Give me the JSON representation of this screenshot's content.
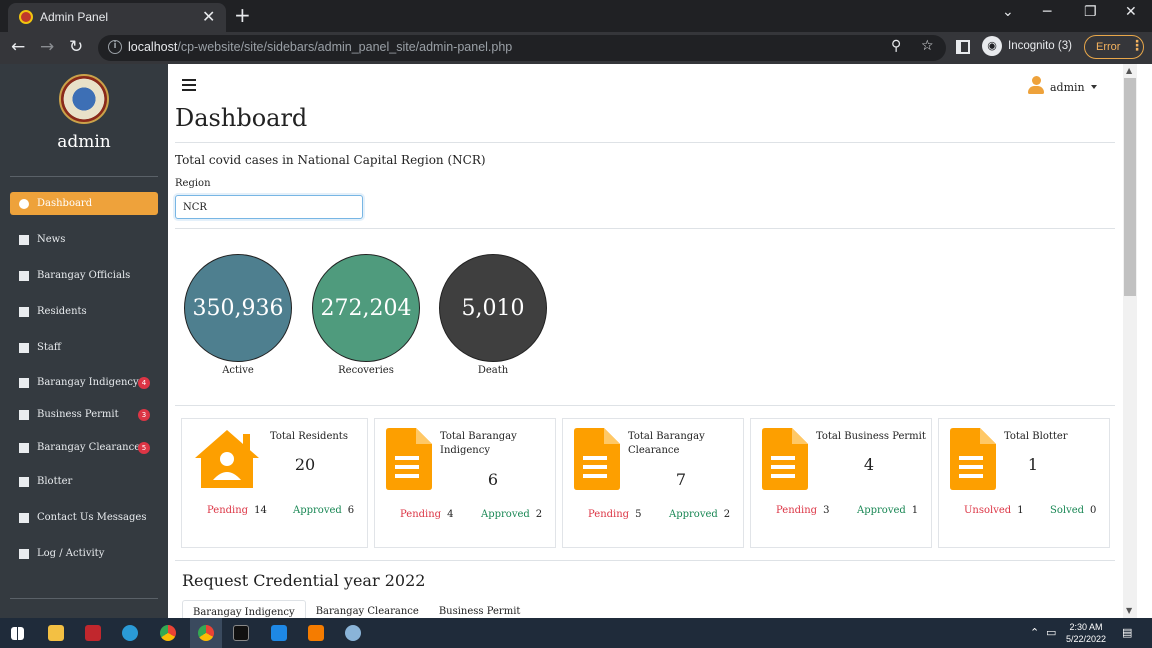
{
  "browser": {
    "tab_title": "Admin Panel",
    "tab_close": "✕",
    "new_tab": "+",
    "url_host": "localhost",
    "url_path": "/cp-website/site/sidebars/admin_panel_site/admin-panel.php",
    "incognito_label": "Incognito (3)",
    "error_label": "Error"
  },
  "sidebar": {
    "username": "admin",
    "items": [
      {
        "label": "Dashboard",
        "icon": "dashboard-icon",
        "active": true
      },
      {
        "label": "News",
        "icon": "newspaper-icon"
      },
      {
        "label": "Barangay Officials",
        "icon": "user-icon"
      },
      {
        "label": "Residents",
        "icon": "users-icon"
      },
      {
        "label": "Staff",
        "icon": "users-icon"
      },
      {
        "label": "Barangay Indigency",
        "icon": "file-icon",
        "badge": "4"
      },
      {
        "label": "Business Permit",
        "icon": "file-icon",
        "badge": "3"
      },
      {
        "label": "Barangay Clearance",
        "icon": "file-icon",
        "badge": "5"
      },
      {
        "label": "Blotter",
        "icon": "file-icon"
      },
      {
        "label": "Contact Us Messages",
        "icon": "file-icon"
      },
      {
        "label": "Log / Activity",
        "icon": "clipboard-check-icon"
      }
    ]
  },
  "header": {
    "user": "admin"
  },
  "main": {
    "title": "Dashboard",
    "subtitle": "Total covid cases in National Capital Region (NCR)",
    "region_label": "Region",
    "region_value": "NCR",
    "stats": [
      {
        "value": "350,936",
        "label": "Active",
        "color": "#4e7f8f"
      },
      {
        "value": "272,204",
        "label": "Recoveries",
        "color": "#4f9b7d"
      },
      {
        "value": "5,010",
        "label": "Death",
        "color": "#3f3f3f"
      }
    ],
    "cards": [
      {
        "title": "Total Residents",
        "value": "20",
        "icon": "house-user-icon",
        "left_label": "Pending",
        "left_count": "14",
        "right_label": "Approved",
        "right_count": "6"
      },
      {
        "title": "Total Barangay Indigency",
        "value": "6",
        "icon": "document-icon",
        "left_label": "Pending",
        "left_count": "4",
        "right_label": "Approved",
        "right_count": "2"
      },
      {
        "title": "Total Barangay Clearance",
        "value": "7",
        "icon": "document-icon",
        "left_label": "Pending",
        "left_count": "5",
        "right_label": "Approved",
        "right_count": "2"
      },
      {
        "title": "Total Business Permit",
        "value": "4",
        "icon": "document-icon",
        "left_label": "Pending",
        "left_count": "3",
        "right_label": "Approved",
        "right_count": "1"
      },
      {
        "title": "Total Blotter",
        "value": "1",
        "icon": "document-icon",
        "left_label": "Unsolved",
        "left_count": "1",
        "right_label": "Solved",
        "right_count": "0"
      }
    ],
    "section_title": "Request Credential year 2022",
    "tabs": [
      "Barangay Indigency",
      "Barangay Clearance",
      "Business Permit"
    ]
  },
  "taskbar": {
    "time": "2:30 AM",
    "date": "5/22/2022"
  },
  "colors": {
    "accent": "#eea23b",
    "sidebar_bg": "#343a40",
    "pending": "#dc3545",
    "approved": "#198754"
  }
}
